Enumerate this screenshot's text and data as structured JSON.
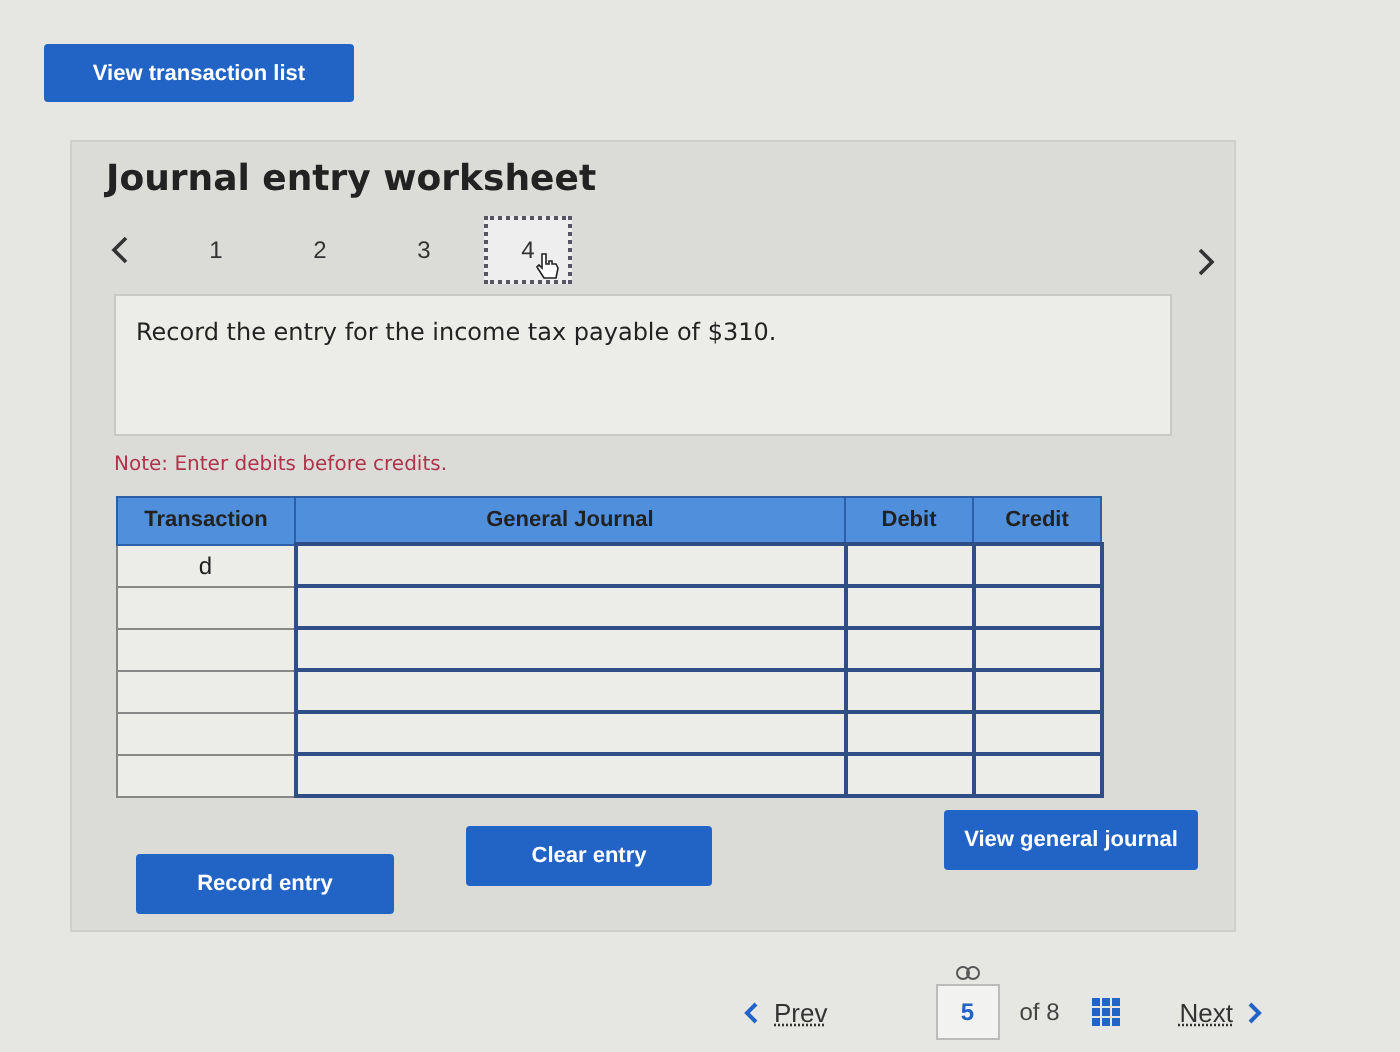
{
  "top_button": "View transaction list",
  "worksheet": {
    "title": "Journal entry worksheet",
    "steps": [
      {
        "label": "1",
        "selected": false
      },
      {
        "label": "2",
        "selected": false
      },
      {
        "label": "3",
        "selected": false
      },
      {
        "label": "4",
        "selected": true
      }
    ],
    "prompt": "Record the entry for the income tax payable of $310.",
    "note": "Note: Enter debits before credits.",
    "table": {
      "columns": [
        "Transaction",
        "General Journal",
        "Debit",
        "Credit"
      ],
      "rows": [
        [
          "d",
          "",
          "",
          ""
        ],
        [
          "",
          "",
          "",
          ""
        ],
        [
          "",
          "",
          "",
          ""
        ],
        [
          "",
          "",
          "",
          ""
        ],
        [
          "",
          "",
          "",
          ""
        ],
        [
          "",
          "",
          "",
          ""
        ]
      ]
    },
    "buttons": [
      "Record entry",
      "Clear entry",
      "View general journal"
    ]
  },
  "footer": {
    "prev": "Prev",
    "page": "5",
    "of": "of 8",
    "next": "Next"
  }
}
